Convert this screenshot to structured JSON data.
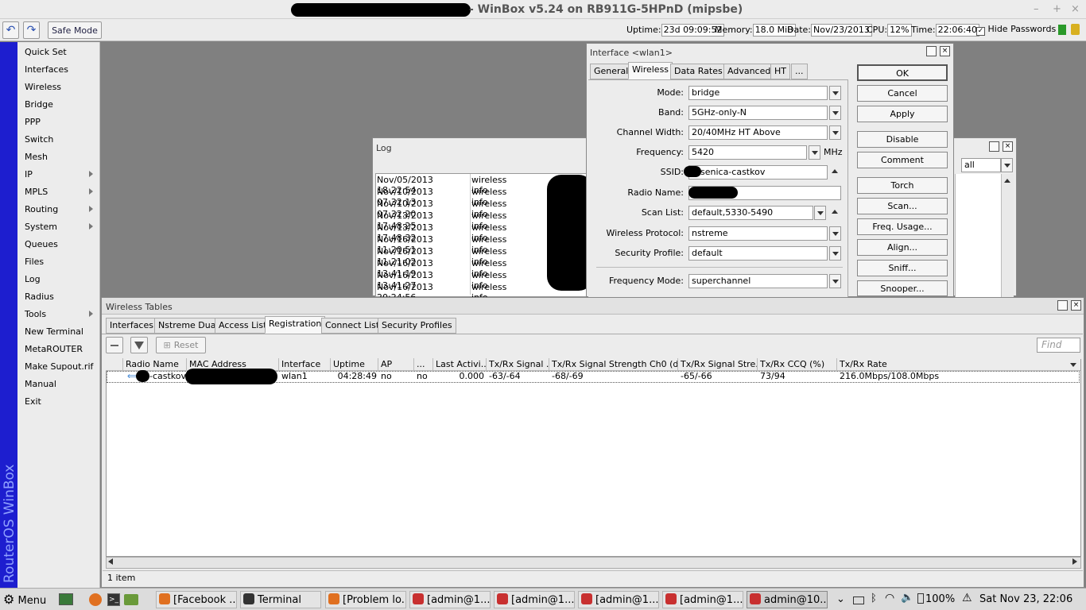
{
  "window": {
    "title_suffix": "- WinBox v5.24 on RB911G-5HPnD (mipsbe)",
    "controls": [
      "–",
      "+",
      "×"
    ]
  },
  "toolbar": {
    "safe_mode": "Safe Mode",
    "uptime_label": "Uptime:",
    "uptime": "23d 09:09:52",
    "memory_label": "Memory:",
    "memory": "18.0 MiB",
    "date_label": "Date:",
    "date": "Nov/23/2013",
    "cpu_label": "CPU:",
    "cpu": "12%",
    "time_label": "Time:",
    "time": "22:06:40",
    "hide_passwords": "Hide Passwords"
  },
  "sidebar": {
    "brand": "RouterOS WinBox",
    "items": [
      "Quick Set",
      "Interfaces",
      "Wireless",
      "Bridge",
      "PPP",
      "Switch",
      "Mesh",
      "IP",
      "MPLS",
      "Routing",
      "System",
      "Queues",
      "Files",
      "Log",
      "Radius",
      "Tools",
      "New Terminal",
      "MetaROUTER",
      "Make Supout.rif",
      "Manual",
      "Exit"
    ]
  },
  "interface_window": {
    "title": "Interface <wlan1>",
    "tabs": [
      "General",
      "Wireless",
      "Data Rates",
      "Advanced",
      "HT",
      "..."
    ],
    "fields": {
      "mode_label": "Mode:",
      "mode": "bridge",
      "band_label": "Band:",
      "band": "5GHz-only-N",
      "channel_width_label": "Channel Width:",
      "channel_width": "20/40MHz HT Above",
      "frequency_label": "Frequency:",
      "frequency": "5420",
      "frequency_unit": "MHz",
      "ssid_label": "SSID:",
      "ssid": "senica-castkov",
      "radio_name_label": "Radio Name:",
      "scan_list_label": "Scan List:",
      "scan_list": "default,5330-5490",
      "wireless_protocol_label": "Wireless Protocol:",
      "wireless_protocol": "nstreme",
      "security_profile_label": "Security Profile:",
      "security_profile": "default",
      "frequency_mode_label": "Frequency Mode:",
      "frequency_mode": "superchannel"
    },
    "buttons": [
      "OK",
      "Cancel",
      "Apply",
      "Disable",
      "Comment",
      "Torch",
      "Scan...",
      "Freq. Usage...",
      "Align...",
      "Sniff...",
      "Snooper..."
    ]
  },
  "log_window": {
    "title": "Log",
    "filter": "all",
    "rows": [
      {
        "time": "Nov/05/2013 18:22:54",
        "topic": "wireless info"
      },
      {
        "time": "Nov/10/2013 07:32:13",
        "topic": "wireless info"
      },
      {
        "time": "Nov/10/2013 07:32:20",
        "topic": "wireless info"
      },
      {
        "time": "Nov/13/2013 17:48:25",
        "topic": "wireless info"
      },
      {
        "time": "Nov/13/2013 17:48:32",
        "topic": "wireless info"
      },
      {
        "time": "Nov/16/2013 11:20:51",
        "topic": "wireless info"
      },
      {
        "time": "Nov/16/2013 11:21:02",
        "topic": "wireless info"
      },
      {
        "time": "Nov/16/2013 13:41:19",
        "topic": "wireless info"
      },
      {
        "time": "Nov/16/2013 13:41:27",
        "topic": "wireless info"
      },
      {
        "time": "Nov/16/2013 20:24:56",
        "topic": "wireless info"
      }
    ]
  },
  "wireless_tables": {
    "title": "Wireless Tables",
    "tabs": [
      "Interfaces",
      "Nstreme Dual",
      "Access List",
      "Registration",
      "Connect List",
      "Security Profiles"
    ],
    "reset": "Reset",
    "find_placeholder": "Find",
    "columns": [
      "Radio Name",
      "MAC Address",
      "Interface",
      "Uptime",
      "AP",
      "...",
      "Last Activi...",
      "Tx/Rx Signal ...",
      "Tx/Rx Signal Strength Ch0 (dBm)",
      "Tx/Rx Signal Stre...",
      "Tx/Rx CCQ (%)",
      "Tx/Rx Rate"
    ],
    "rows": [
      {
        "radio_name": "-castkov",
        "mac": "",
        "interface": "wlan1",
        "uptime": "04:28:49",
        "ap": "no",
        "wds": "no",
        "last_activity": "0.000",
        "signal": "-63/-64",
        "signal_ch0": "-68/-69",
        "signal_ch1": "-65/-66",
        "ccq": "73/94",
        "rate": "216.0Mbps/108.0Mbps"
      }
    ],
    "status": "1 item"
  },
  "taskbar": {
    "menu": "Menu",
    "tasks": [
      "[Facebook ...",
      "Terminal",
      "[Problem lo...",
      "[admin@1...",
      "[admin@1...",
      "[admin@1...",
      "[admin@1...",
      "admin@10..."
    ],
    "battery": "100%",
    "clock": "Sat Nov 23, 22:06"
  },
  "colors": {
    "sidebar_brand": "#1d1ecf",
    "window_bg": "#ececec",
    "desktop": "#808080"
  }
}
